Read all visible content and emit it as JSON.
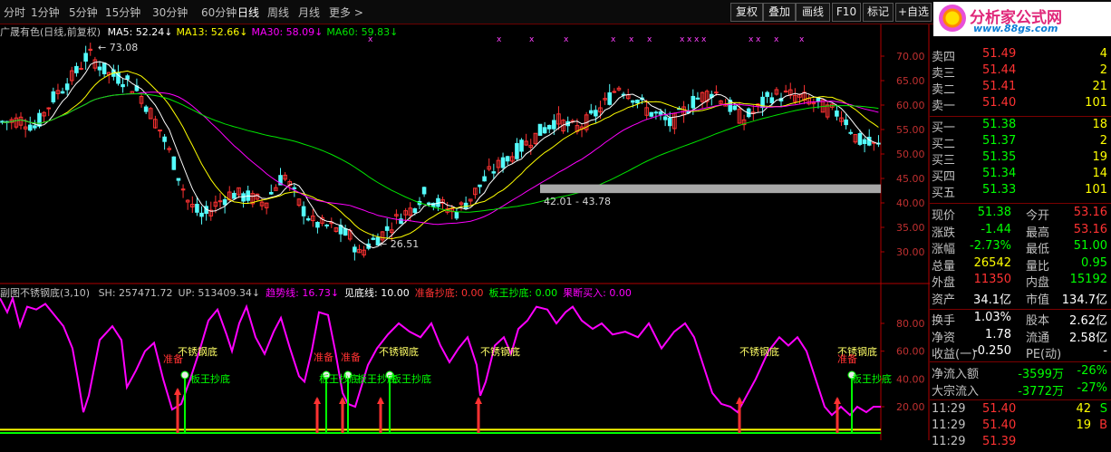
{
  "toolbar": {
    "periods": [
      "分时",
      "1分钟",
      "5分钟",
      "15分钟",
      "30分钟",
      "60分钟",
      "日线",
      "周线",
      "月线",
      "更多 >"
    ],
    "active_period": "日线",
    "buttons": [
      "复权",
      "叠加",
      "画线",
      "F10",
      "标记",
      "+自选"
    ]
  },
  "logo": {
    "title": "分析家公式网",
    "url": "www.88gs.com"
  },
  "colors": {
    "up": "#ff3232",
    "down": "#54fcfc",
    "ma5": "#ffffff",
    "ma13": "#ffff00",
    "ma30": "#ff00ff",
    "ma60": "#00e600",
    "zhuanwang": "#ff00ff",
    "sell": "#ff3232",
    "buy": "#00ff00",
    "axis": "#b00000"
  },
  "main_chart": {
    "title": "广晟有色(日线,前复权)",
    "ma": [
      {
        "label": "MA5:",
        "value": "52.24↓",
        "color": "#ffffff"
      },
      {
        "label": "MA13:",
        "value": "52.66↓",
        "color": "#ffff00"
      },
      {
        "label": "MA30:",
        "value": "58.09↓",
        "color": "#ff00ff"
      },
      {
        "label": "MA60:",
        "value": "59.83↓",
        "color": "#00e600"
      }
    ],
    "yticks": [
      "70.00",
      "65.00",
      "60.00",
      "55.00",
      "50.00",
      "45.00",
      "40.00",
      "35.00",
      "30.00"
    ],
    "high_label": "73.08",
    "low_label": "26.51",
    "band_label": "42.01 - 43.78",
    "marks": "x"
  },
  "indicator": {
    "title": "副图不锈钢底(3,10)",
    "values": [
      {
        "text": "SH: 257471.72",
        "color": "#c0c0c0"
      },
      {
        "text": "UP: 513409.34↓",
        "color": "#c0c0c0"
      },
      {
        "text": "趋势线: 16.73↓",
        "color": "#ff00ff"
      },
      {
        "text": "见底线: 10.00",
        "color": "#ffffff"
      },
      {
        "text": "准备抄底: 0.00",
        "color": "#ff3232"
      },
      {
        "text": "板王抄底: 0.00",
        "color": "#00ff00"
      },
      {
        "text": "果断买入: 0.00",
        "color": "#ff00ff"
      }
    ],
    "yticks": [
      "80.00",
      "60.00",
      "40.00",
      "20.00"
    ],
    "labels": {
      "bottom": "不锈钢底",
      "ready": "准备",
      "ready2": "准备",
      "board": "板王抄底"
    }
  },
  "quote": {
    "asks": [
      {
        "label": "卖四",
        "price": "51.49",
        "vol": "4"
      },
      {
        "label": "卖三",
        "price": "51.44",
        "vol": "2"
      },
      {
        "label": "卖二",
        "price": "51.41",
        "vol": "21"
      },
      {
        "label": "卖一",
        "price": "51.40",
        "vol": "101"
      }
    ],
    "bids": [
      {
        "label": "买一",
        "price": "51.38",
        "vol": "18"
      },
      {
        "label": "买二",
        "price": "51.37",
        "vol": "2"
      },
      {
        "label": "买三",
        "price": "51.35",
        "vol": "19"
      },
      {
        "label": "买四",
        "price": "51.34",
        "vol": "14"
      },
      {
        "label": "买五",
        "price": "51.33",
        "vol": "101"
      }
    ],
    "stats": [
      {
        "l1": "现价",
        "v1": "51.38",
        "c1": "#00ff00",
        "l2": "今开",
        "v2": "53.16",
        "c2": "#ff3232"
      },
      {
        "l1": "涨跌",
        "v1": "-1.44",
        "c1": "#00ff00",
        "l2": "最高",
        "v2": "53.16",
        "c2": "#ff3232"
      },
      {
        "l1": "涨幅",
        "v1": "-2.73%",
        "c1": "#00ff00",
        "l2": "最低",
        "v2": "51.00",
        "c2": "#00ff00"
      },
      {
        "l1": "总量",
        "v1": "26542",
        "c1": "#ffff00",
        "l2": "量比",
        "v2": "0.95",
        "c2": "#00ff00"
      },
      {
        "l1": "外盘",
        "v1": "11350",
        "c1": "#ff3232",
        "l2": "内盘",
        "v2": "15192",
        "c2": "#00ff00"
      },
      {
        "l1": "资产",
        "v1": "34.1亿",
        "c1": "#ffffff",
        "l2": "市值",
        "v2": "134.7亿",
        "c2": "#ffffff"
      }
    ],
    "stats2": [
      {
        "l1": "换手",
        "v1": "1.03%",
        "c1": "#ffffff",
        "l2": "股本",
        "v2": "2.62亿",
        "c2": "#ffffff"
      },
      {
        "l1": "净资",
        "v1": "1.78",
        "c1": "#ffffff",
        "l2": "流通",
        "v2": "2.58亿",
        "c2": "#ffffff"
      },
      {
        "l1": "收益(一)",
        "v1": "-0.250",
        "c1": "#ffffff",
        "l2": "PE(动)",
        "v2": "-",
        "c2": "#ffffff"
      }
    ],
    "flows": [
      {
        "label": "净流入额",
        "value": "-3599万",
        "pct": "-26%"
      },
      {
        "label": "大宗流入",
        "value": "-3772万",
        "pct": "-27%"
      }
    ],
    "ticks": [
      {
        "time": "11:29",
        "price": "51.40",
        "vol": "42",
        "side": "S",
        "c": "#00ff00"
      },
      {
        "time": "11:29",
        "price": "51.40",
        "vol": "19",
        "side": "B",
        "c": "#ff3232"
      },
      {
        "time": "11:29",
        "price": "51.39",
        "vol": "",
        "side": "",
        "c": "#00ff00"
      }
    ]
  }
}
